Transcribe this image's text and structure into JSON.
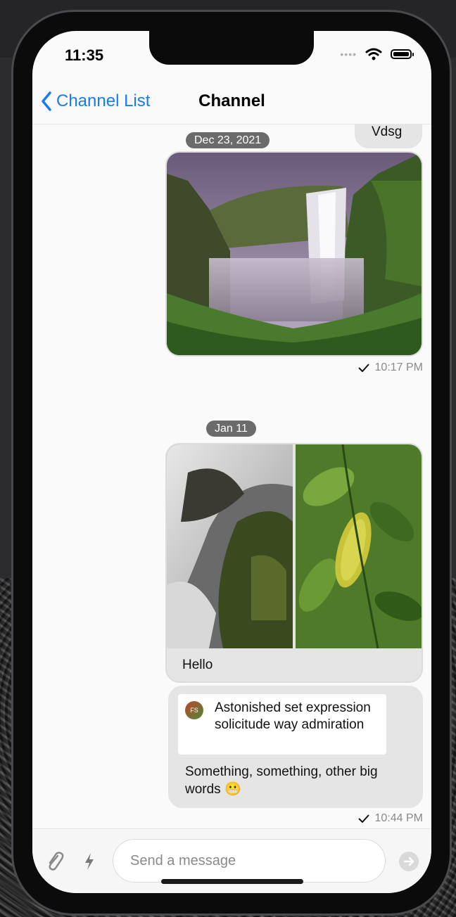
{
  "status_bar": {
    "time": "11:35"
  },
  "nav": {
    "back_label": "Channel List",
    "title": "Channel"
  },
  "messages": {
    "prev_text": "Vdsg",
    "date1": "Dec 23, 2021",
    "msg1_time": "10:17 PM",
    "date2": "Jan 11",
    "msg2_text": "Hello",
    "msg3_quote_initials": "FS",
    "msg3_quote_text": "Astonished set expression solicitude way admiration",
    "msg3_text": "Something, something, other big words 😬",
    "msg3_time": "10:44 PM"
  },
  "composer": {
    "placeholder": "Send a message"
  },
  "colors": {
    "accent": "#1a7bf0",
    "bubble": "#e5e5e5",
    "date_pill": "#6b6b6b"
  },
  "icons": [
    "chevron-left-icon",
    "wifi-icon",
    "battery-icon",
    "checkmark-icon",
    "paperclip-icon",
    "lightning-icon",
    "send-icon"
  ]
}
